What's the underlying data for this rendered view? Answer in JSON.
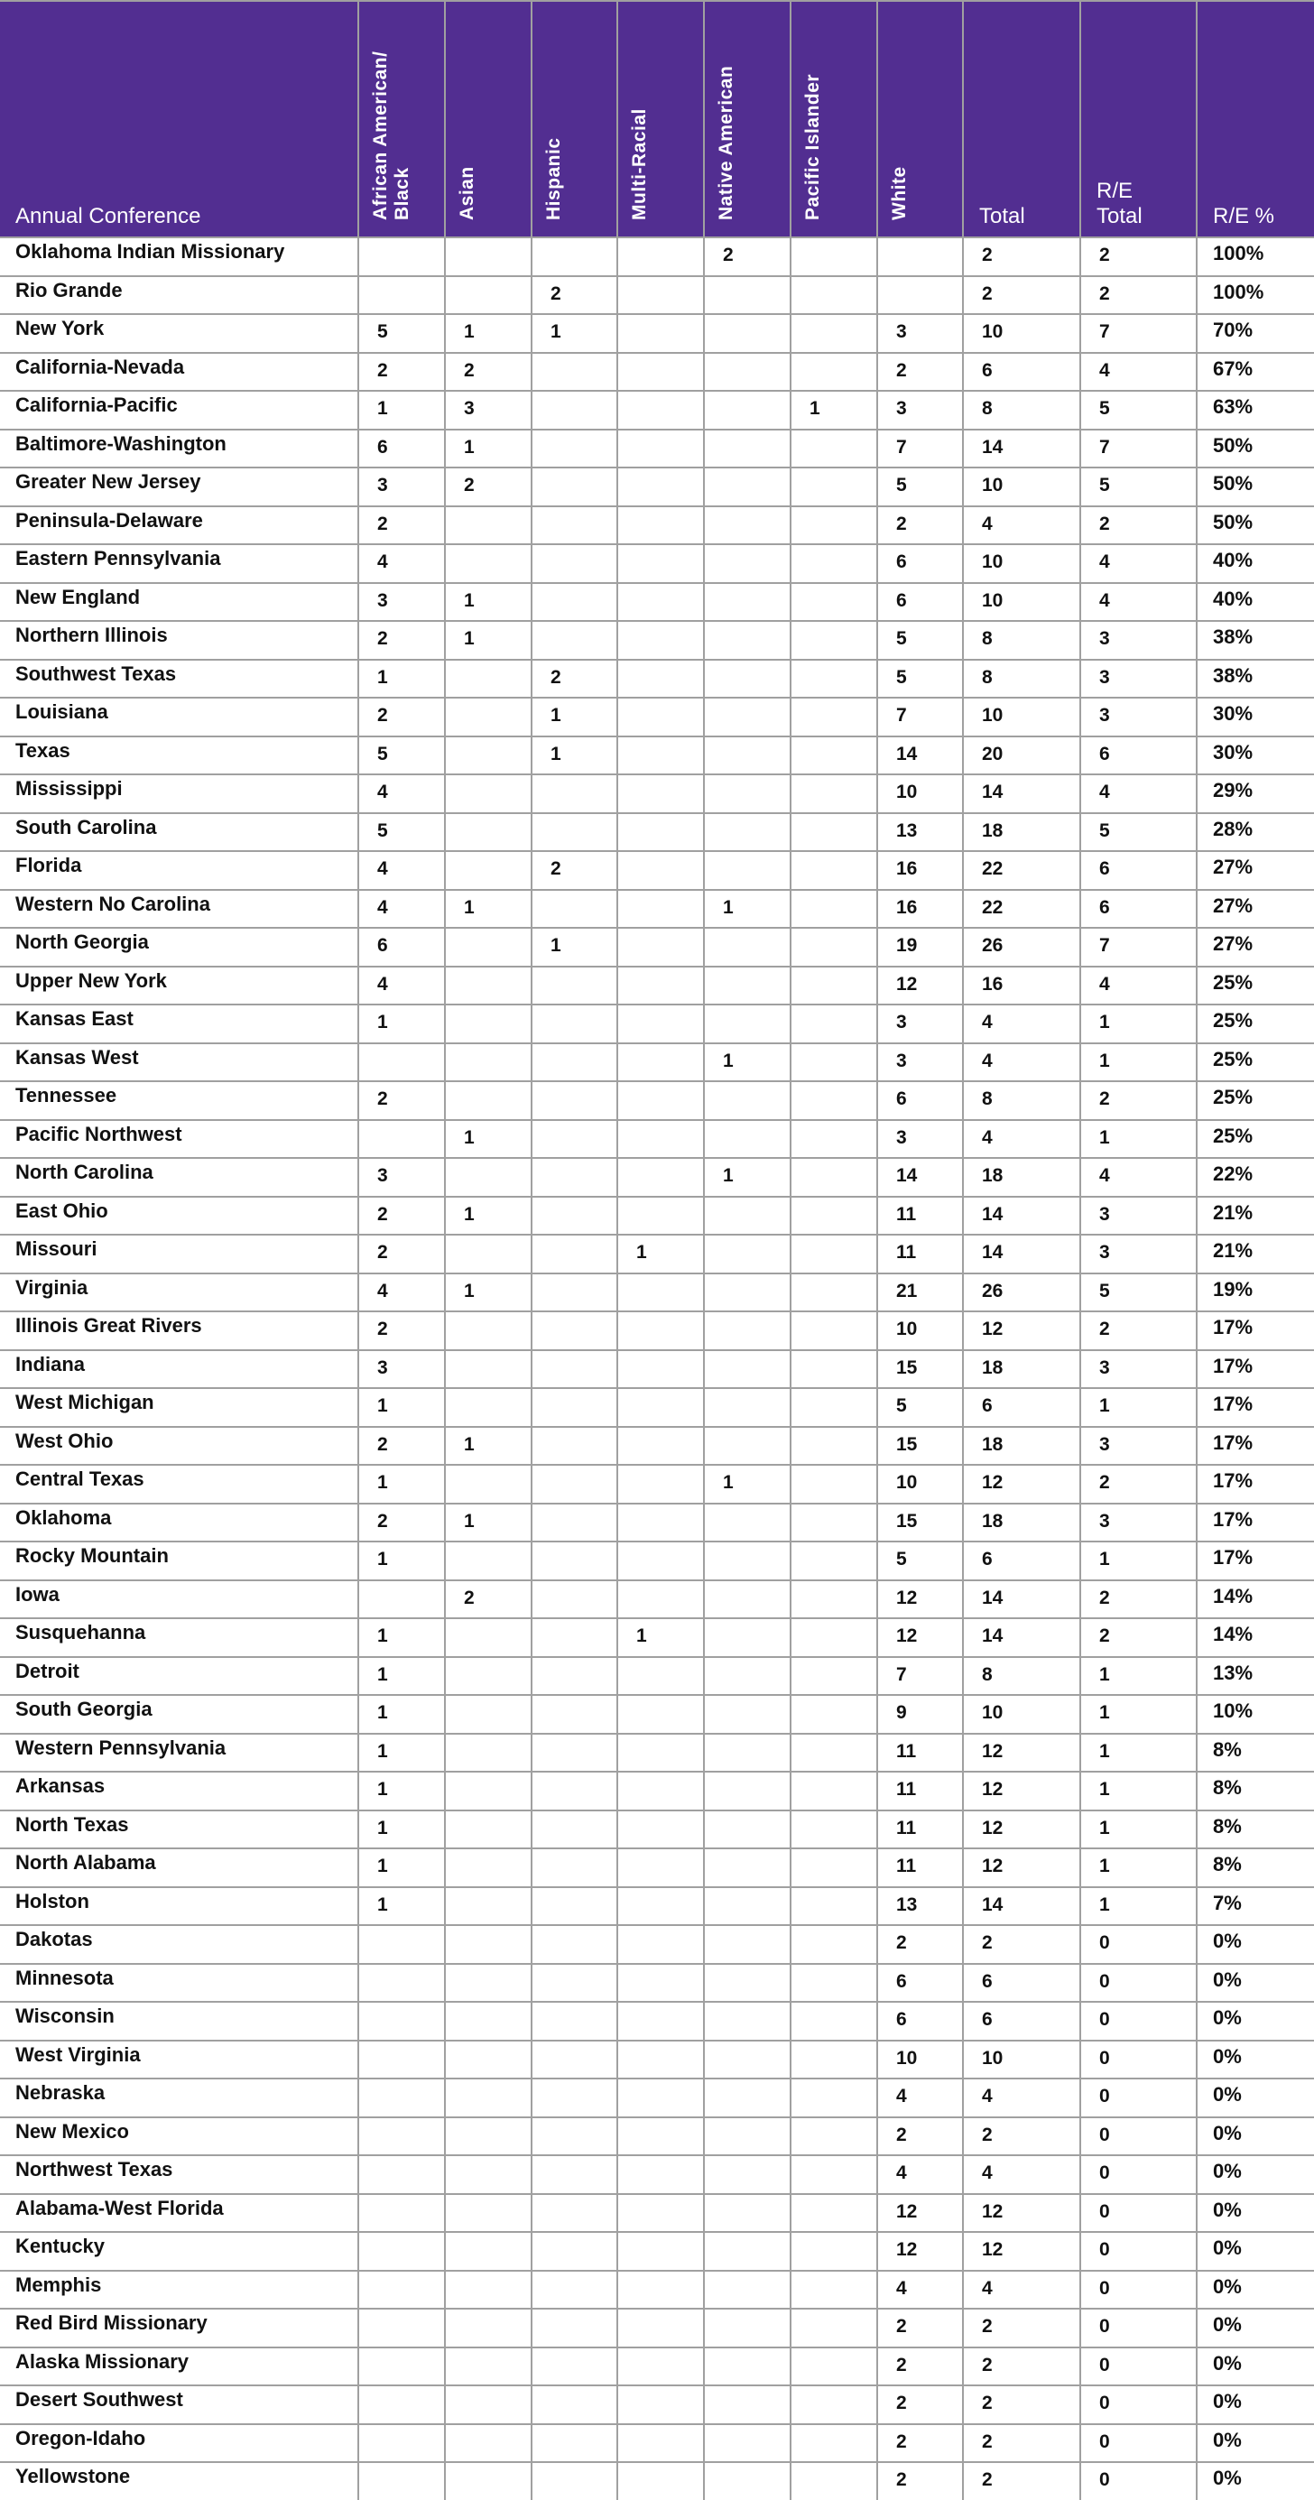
{
  "table": {
    "columns": [
      {
        "key": "conference",
        "label": "Annual Conference",
        "orientation": "horizontal"
      },
      {
        "key": "african_american_black",
        "label": "African American/\nBlack",
        "orientation": "vertical"
      },
      {
        "key": "asian",
        "label": "Asian",
        "orientation": "vertical"
      },
      {
        "key": "hispanic",
        "label": "Hispanic",
        "orientation": "vertical"
      },
      {
        "key": "multi_racial",
        "label": "Multi-Racial",
        "orientation": "vertical"
      },
      {
        "key": "native_american",
        "label": "Native American",
        "orientation": "vertical"
      },
      {
        "key": "pacific_islander",
        "label": "Pacific Islander",
        "orientation": "vertical"
      },
      {
        "key": "white",
        "label": "White",
        "orientation": "vertical"
      },
      {
        "key": "total",
        "label": "Total",
        "orientation": "horizontal"
      },
      {
        "key": "re_total",
        "label": "R/E\nTotal",
        "orientation": "horizontal"
      },
      {
        "key": "re_pct",
        "label": "R/E %",
        "orientation": "horizontal"
      }
    ],
    "header_color": "#522e91",
    "grid_color": "#a0a0a0",
    "rows": [
      [
        "Oklahoma Indian Missionary",
        "",
        "",
        "",
        "",
        "2",
        "",
        "",
        "2",
        "2",
        "100%"
      ],
      [
        "Rio Grande",
        "",
        "",
        "2",
        "",
        "",
        "",
        "",
        "2",
        "2",
        "100%"
      ],
      [
        "New York",
        "5",
        "1",
        "1",
        "",
        "",
        "",
        "3",
        "10",
        "7",
        "70%"
      ],
      [
        "California-Nevada",
        "2",
        "2",
        "",
        "",
        "",
        "",
        "2",
        "6",
        "4",
        "67%"
      ],
      [
        "California-Pacific",
        "1",
        "3",
        "",
        "",
        "",
        "1",
        "3",
        "8",
        "5",
        "63%"
      ],
      [
        "Baltimore-Washington",
        "6",
        "1",
        "",
        "",
        "",
        "",
        "7",
        "14",
        "7",
        "50%"
      ],
      [
        "Greater New Jersey",
        "3",
        "2",
        "",
        "",
        "",
        "",
        "5",
        "10",
        "5",
        "50%"
      ],
      [
        "Peninsula-Delaware",
        "2",
        "",
        "",
        "",
        "",
        "",
        "2",
        "4",
        "2",
        "50%"
      ],
      [
        "Eastern Pennsylvania",
        "4",
        "",
        "",
        "",
        "",
        "",
        "6",
        "10",
        "4",
        "40%"
      ],
      [
        "New England",
        "3",
        "1",
        "",
        "",
        "",
        "",
        "6",
        "10",
        "4",
        "40%"
      ],
      [
        "Northern Illinois",
        "2",
        "1",
        "",
        "",
        "",
        "",
        "5",
        "8",
        "3",
        "38%"
      ],
      [
        "Southwest Texas",
        "1",
        "",
        "2",
        "",
        "",
        "",
        "5",
        "8",
        "3",
        "38%"
      ],
      [
        "Louisiana",
        "2",
        "",
        "1",
        "",
        "",
        "",
        "7",
        "10",
        "3",
        "30%"
      ],
      [
        "Texas",
        "5",
        "",
        "1",
        "",
        "",
        "",
        "14",
        "20",
        "6",
        "30%"
      ],
      [
        "Mississippi",
        "4",
        "",
        "",
        "",
        "",
        "",
        "10",
        "14",
        "4",
        "29%"
      ],
      [
        "South Carolina",
        "5",
        "",
        "",
        "",
        "",
        "",
        "13",
        "18",
        "5",
        "28%"
      ],
      [
        "Florida",
        "4",
        "",
        "2",
        "",
        "",
        "",
        "16",
        "22",
        "6",
        "27%"
      ],
      [
        "Western No Carolina",
        "4",
        "1",
        "",
        "",
        "1",
        "",
        "16",
        "22",
        "6",
        "27%"
      ],
      [
        "North Georgia",
        "6",
        "",
        "1",
        "",
        "",
        "",
        "19",
        "26",
        "7",
        "27%"
      ],
      [
        "Upper New York",
        "4",
        "",
        "",
        "",
        "",
        "",
        "12",
        "16",
        "4",
        "25%"
      ],
      [
        "Kansas East",
        "1",
        "",
        "",
        "",
        "",
        "",
        "3",
        "4",
        "1",
        "25%"
      ],
      [
        "Kansas West",
        "",
        "",
        "",
        "",
        "1",
        "",
        "3",
        "4",
        "1",
        "25%"
      ],
      [
        "Tennessee",
        "2",
        "",
        "",
        "",
        "",
        "",
        "6",
        "8",
        "2",
        "25%"
      ],
      [
        "Pacific Northwest",
        "",
        "1",
        "",
        "",
        "",
        "",
        "3",
        "4",
        "1",
        "25%"
      ],
      [
        "North Carolina",
        "3",
        "",
        "",
        "",
        "1",
        "",
        "14",
        "18",
        "4",
        "22%"
      ],
      [
        "East Ohio",
        "2",
        "1",
        "",
        "",
        "",
        "",
        "11",
        "14",
        "3",
        "21%"
      ],
      [
        "Missouri",
        "2",
        "",
        "",
        "1",
        "",
        "",
        "11",
        "14",
        "3",
        "21%"
      ],
      [
        "Virginia",
        "4",
        "1",
        "",
        "",
        "",
        "",
        "21",
        "26",
        "5",
        "19%"
      ],
      [
        "Illinois Great Rivers",
        "2",
        "",
        "",
        "",
        "",
        "",
        "10",
        "12",
        "2",
        "17%"
      ],
      [
        "Indiana",
        "3",
        "",
        "",
        "",
        "",
        "",
        "15",
        "18",
        "3",
        "17%"
      ],
      [
        "West Michigan",
        "1",
        "",
        "",
        "",
        "",
        "",
        "5",
        "6",
        "1",
        "17%"
      ],
      [
        "West Ohio",
        "2",
        "1",
        "",
        "",
        "",
        "",
        "15",
        "18",
        "3",
        "17%"
      ],
      [
        "Central Texas",
        "1",
        "",
        "",
        "",
        "1",
        "",
        "10",
        "12",
        "2",
        "17%"
      ],
      [
        "Oklahoma",
        "2",
        "1",
        "",
        "",
        "",
        "",
        "15",
        "18",
        "3",
        "17%"
      ],
      [
        "Rocky Mountain",
        "1",
        "",
        "",
        "",
        "",
        "",
        "5",
        "6",
        "1",
        "17%"
      ],
      [
        "Iowa",
        "",
        "2",
        "",
        "",
        "",
        "",
        "12",
        "14",
        "2",
        "14%"
      ],
      [
        "Susquehanna",
        "1",
        "",
        "",
        "1",
        "",
        "",
        "12",
        "14",
        "2",
        "14%"
      ],
      [
        "Detroit",
        "1",
        "",
        "",
        "",
        "",
        "",
        "7",
        "8",
        "1",
        "13%"
      ],
      [
        "South Georgia",
        "1",
        "",
        "",
        "",
        "",
        "",
        "9",
        "10",
        "1",
        "10%"
      ],
      [
        "Western Pennsylvania",
        "1",
        "",
        "",
        "",
        "",
        "",
        "11",
        "12",
        "1",
        "8%"
      ],
      [
        "Arkansas",
        "1",
        "",
        "",
        "",
        "",
        "",
        "11",
        "12",
        "1",
        "8%"
      ],
      [
        "North Texas",
        "1",
        "",
        "",
        "",
        "",
        "",
        "11",
        "12",
        "1",
        "8%"
      ],
      [
        "North Alabama",
        "1",
        "",
        "",
        "",
        "",
        "",
        "11",
        "12",
        "1",
        "8%"
      ],
      [
        "Holston",
        "1",
        "",
        "",
        "",
        "",
        "",
        "13",
        "14",
        "1",
        "7%"
      ],
      [
        "Dakotas",
        "",
        "",
        "",
        "",
        "",
        "",
        "2",
        "2",
        "0",
        "0%"
      ],
      [
        "Minnesota",
        "",
        "",
        "",
        "",
        "",
        "",
        "6",
        "6",
        "0",
        "0%"
      ],
      [
        "Wisconsin",
        "",
        "",
        "",
        "",
        "",
        "",
        "6",
        "6",
        "0",
        "0%"
      ],
      [
        "West Virginia",
        "",
        "",
        "",
        "",
        "",
        "",
        "10",
        "10",
        "0",
        "0%"
      ],
      [
        "Nebraska",
        "",
        "",
        "",
        "",
        "",
        "",
        "4",
        "4",
        "0",
        "0%"
      ],
      [
        "New Mexico",
        "",
        "",
        "",
        "",
        "",
        "",
        "2",
        "2",
        "0",
        "0%"
      ],
      [
        "Northwest Texas",
        "",
        "",
        "",
        "",
        "",
        "",
        "4",
        "4",
        "0",
        "0%"
      ],
      [
        "Alabama-West Florida",
        "",
        "",
        "",
        "",
        "",
        "",
        "12",
        "12",
        "0",
        "0%"
      ],
      [
        "Kentucky",
        "",
        "",
        "",
        "",
        "",
        "",
        "12",
        "12",
        "0",
        "0%"
      ],
      [
        "Memphis",
        "",
        "",
        "",
        "",
        "",
        "",
        "4",
        "4",
        "0",
        "0%"
      ],
      [
        "Red Bird Missionary",
        "",
        "",
        "",
        "",
        "",
        "",
        "2",
        "2",
        "0",
        "0%"
      ],
      [
        "Alaska Missionary",
        "",
        "",
        "",
        "",
        "",
        "",
        "2",
        "2",
        "0",
        "0%"
      ],
      [
        "Desert Southwest",
        "",
        "",
        "",
        "",
        "",
        "",
        "2",
        "2",
        "0",
        "0%"
      ],
      [
        "Oregon-Idaho",
        "",
        "",
        "",
        "",
        "",
        "",
        "2",
        "2",
        "0",
        "0%"
      ],
      [
        "Yellowstone",
        "",
        "",
        "",
        "",
        "",
        "",
        "2",
        "2",
        "0",
        "0%"
      ]
    ]
  }
}
